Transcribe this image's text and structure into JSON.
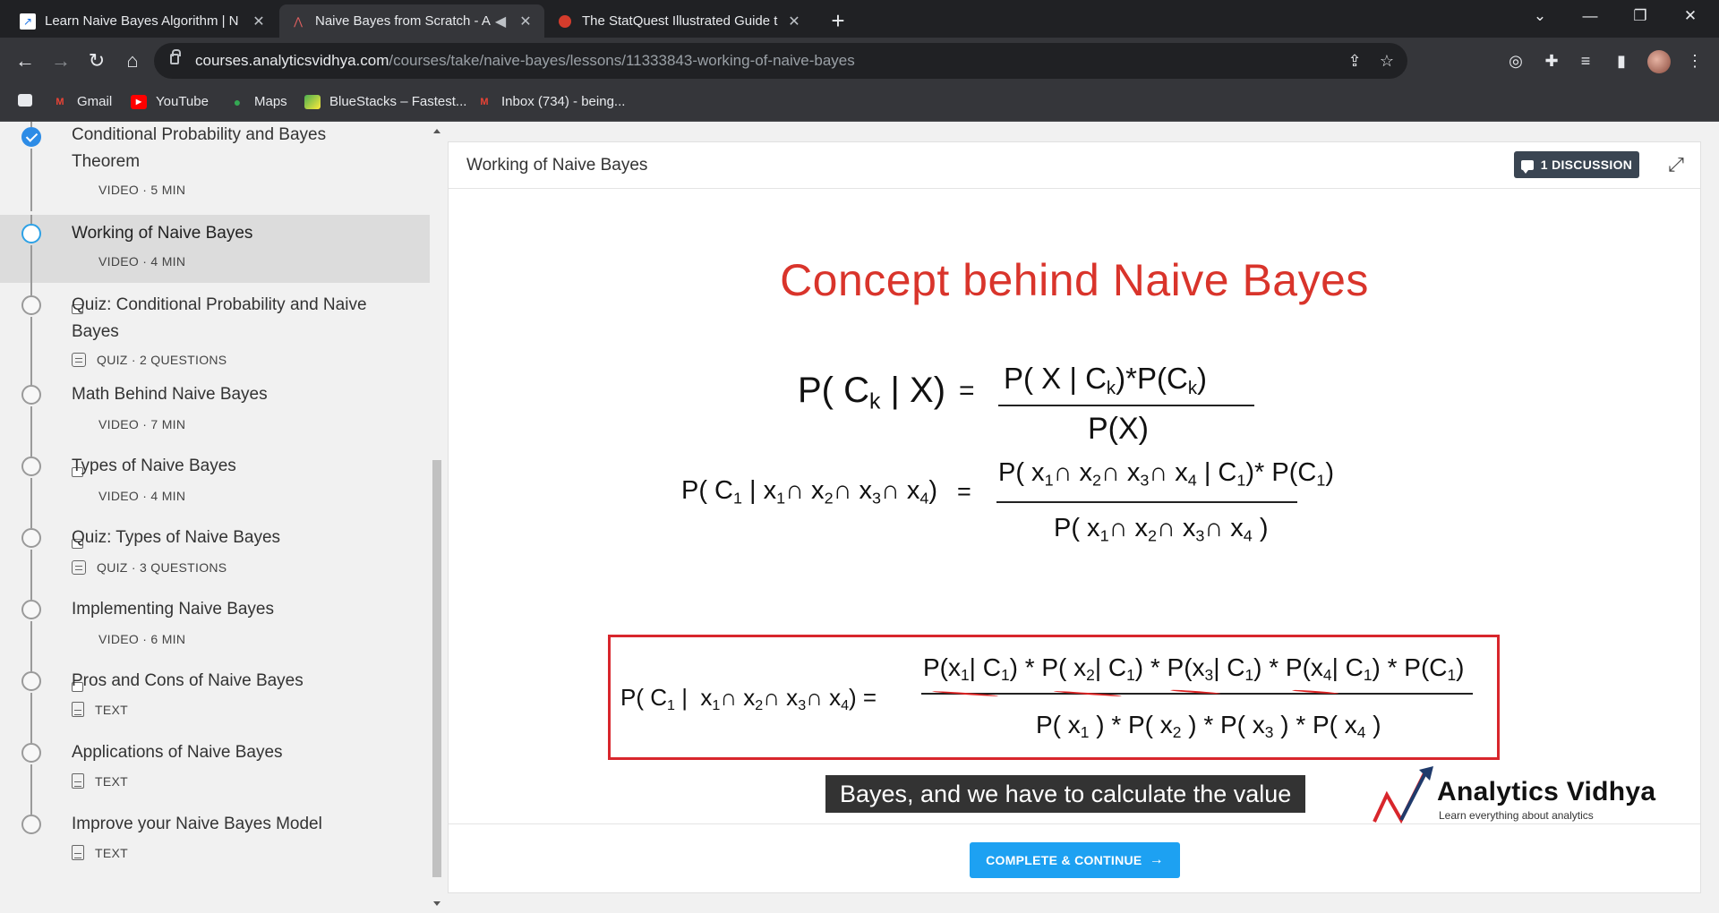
{
  "browser": {
    "tabs": [
      {
        "title": "Learn Naive Bayes Algorithm | N",
        "icon": "analytics-vidhya-favicon",
        "active": false
      },
      {
        "title": "Naive Bayes from Scratch - A",
        "icon": "analytics-vidhya-favicon",
        "active": true,
        "audio": true
      },
      {
        "title": "The StatQuest Illustrated Guide t",
        "icon": "statquest-favicon",
        "active": false
      }
    ],
    "url_host": "courses.analyticsvidhya.com",
    "url_path": "/courses/take/naive-bayes/lessons/11333843-working-of-naive-bayes",
    "bookmarks": [
      {
        "label": "Gmail",
        "icon": "gmail-icon"
      },
      {
        "label": "YouTube",
        "icon": "youtube-icon"
      },
      {
        "label": "Maps",
        "icon": "maps-icon"
      },
      {
        "label": "BlueStacks – Fastest...",
        "icon": "bluestacks-icon"
      },
      {
        "label": "Inbox (734) - being...",
        "icon": "gmail-icon"
      }
    ]
  },
  "sidebar": {
    "lessons": [
      {
        "title": "Conditional Probability and Bayes Theorem",
        "type": "VIDEO",
        "detail": "5 MIN",
        "state": "done"
      },
      {
        "title": "Working of Naive Bayes",
        "type": "VIDEO",
        "detail": "4 MIN",
        "state": "active"
      },
      {
        "title": "Quiz: Conditional Probability and Naive Bayes",
        "type": "QUIZ",
        "detail": "2 QUESTIONS",
        "state": "todo"
      },
      {
        "title": "Math Behind Naive Bayes",
        "type": "VIDEO",
        "detail": "7 MIN",
        "state": "todo"
      },
      {
        "title": "Types of Naive Bayes",
        "type": "VIDEO",
        "detail": "4 MIN",
        "state": "todo"
      },
      {
        "title": "Quiz: Types of Naive Bayes",
        "type": "QUIZ",
        "detail": "3 QUESTIONS",
        "state": "todo"
      },
      {
        "title": "Implementing Naive Bayes",
        "type": "VIDEO",
        "detail": "6 MIN",
        "state": "todo"
      },
      {
        "title": "Pros and Cons of Naive Bayes",
        "type": "TEXT",
        "detail": "",
        "state": "todo"
      },
      {
        "title": "Applications of Naive Bayes",
        "type": "TEXT",
        "detail": "",
        "state": "todo"
      },
      {
        "title": "Improve your Naive Bayes Model",
        "type": "TEXT",
        "detail": "",
        "state": "todo"
      }
    ]
  },
  "content": {
    "title": "Working of Naive Bayes",
    "discussion_label": "1 DISCUSSION",
    "complete_label": "COMPLETE & CONTINUE",
    "complete_arrow": "→"
  },
  "video": {
    "slide_title": "Concept behind Naive Bayes",
    "caption": "Bayes, and we have to calculate the value",
    "logo_name": "Analytics Vidhya",
    "logo_tagline": "Learn everything about analytics"
  },
  "colors": {
    "accent": "#1da1f2",
    "slide_title": "#d9342b",
    "highlight_box": "#d8262c",
    "active_lesson_bg": "#dcdcdc",
    "done_check": "#2d8ce6"
  }
}
